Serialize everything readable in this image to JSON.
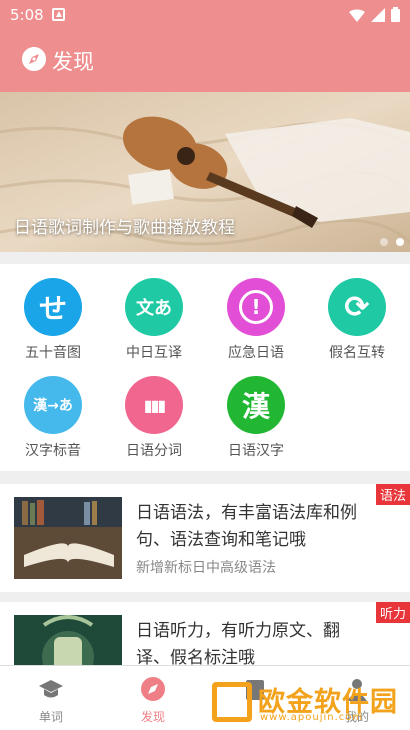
{
  "status_bar": {
    "time": "5:08"
  },
  "app_bar": {
    "title": "发现",
    "icon": "compass-icon"
  },
  "banner": {
    "caption": "日语歌词制作与歌曲播放教程",
    "dots": 2,
    "active_dot": 2
  },
  "features": [
    {
      "label": "五十音图",
      "glyph": "せ",
      "color": "#1aa5e8",
      "icon": "kana-se-icon"
    },
    {
      "label": "中日互译",
      "glyph": "文あ",
      "color": "#1ec9a4",
      "icon": "translate-icon"
    },
    {
      "label": "应急日语",
      "glyph": "!",
      "color": "#e24fd6",
      "icon": "alert-icon"
    },
    {
      "label": "假名互转",
      "glyph": "⟳",
      "color": "#1ec9a4",
      "icon": "kana-convert-icon"
    },
    {
      "label": "汉字标音",
      "glyph": "漢→あ",
      "color": "#45b9ec",
      "icon": "kanji-furigana-icon"
    },
    {
      "label": "日语分词",
      "glyph": "▮▮▮",
      "color": "#f0668f",
      "icon": "segment-icon"
    },
    {
      "label": "日语汉字",
      "glyph": "漢",
      "color": "#22b733",
      "icon": "kanji-icon"
    }
  ],
  "cards": [
    {
      "line1": "日语语法，有丰富语法库和例",
      "line2": "句、语法查询和笔记哦",
      "sub": "新增新标日中高级语法",
      "tag": "语法"
    },
    {
      "line1": "日语听力，有听力原文、翻",
      "line2": "译、假名标注哦",
      "sub": "",
      "tag": "听力"
    }
  ],
  "tabs": [
    {
      "label": "单词",
      "icon": "graduation-cap-icon",
      "active": false
    },
    {
      "label": "发现",
      "icon": "compass-icon",
      "active": true
    },
    {
      "label": "",
      "icon": "book-icon",
      "active": false
    },
    {
      "label": "我的",
      "icon": "person-icon",
      "active": false
    }
  ],
  "colors": {
    "brand": "#ef8e8f",
    "active_tab": "#ef7f86",
    "inactive_tab": "#888888",
    "tag": "#e8353a"
  },
  "watermark": {
    "text": "欧金软件园",
    "url": "www.apoujin.com"
  }
}
